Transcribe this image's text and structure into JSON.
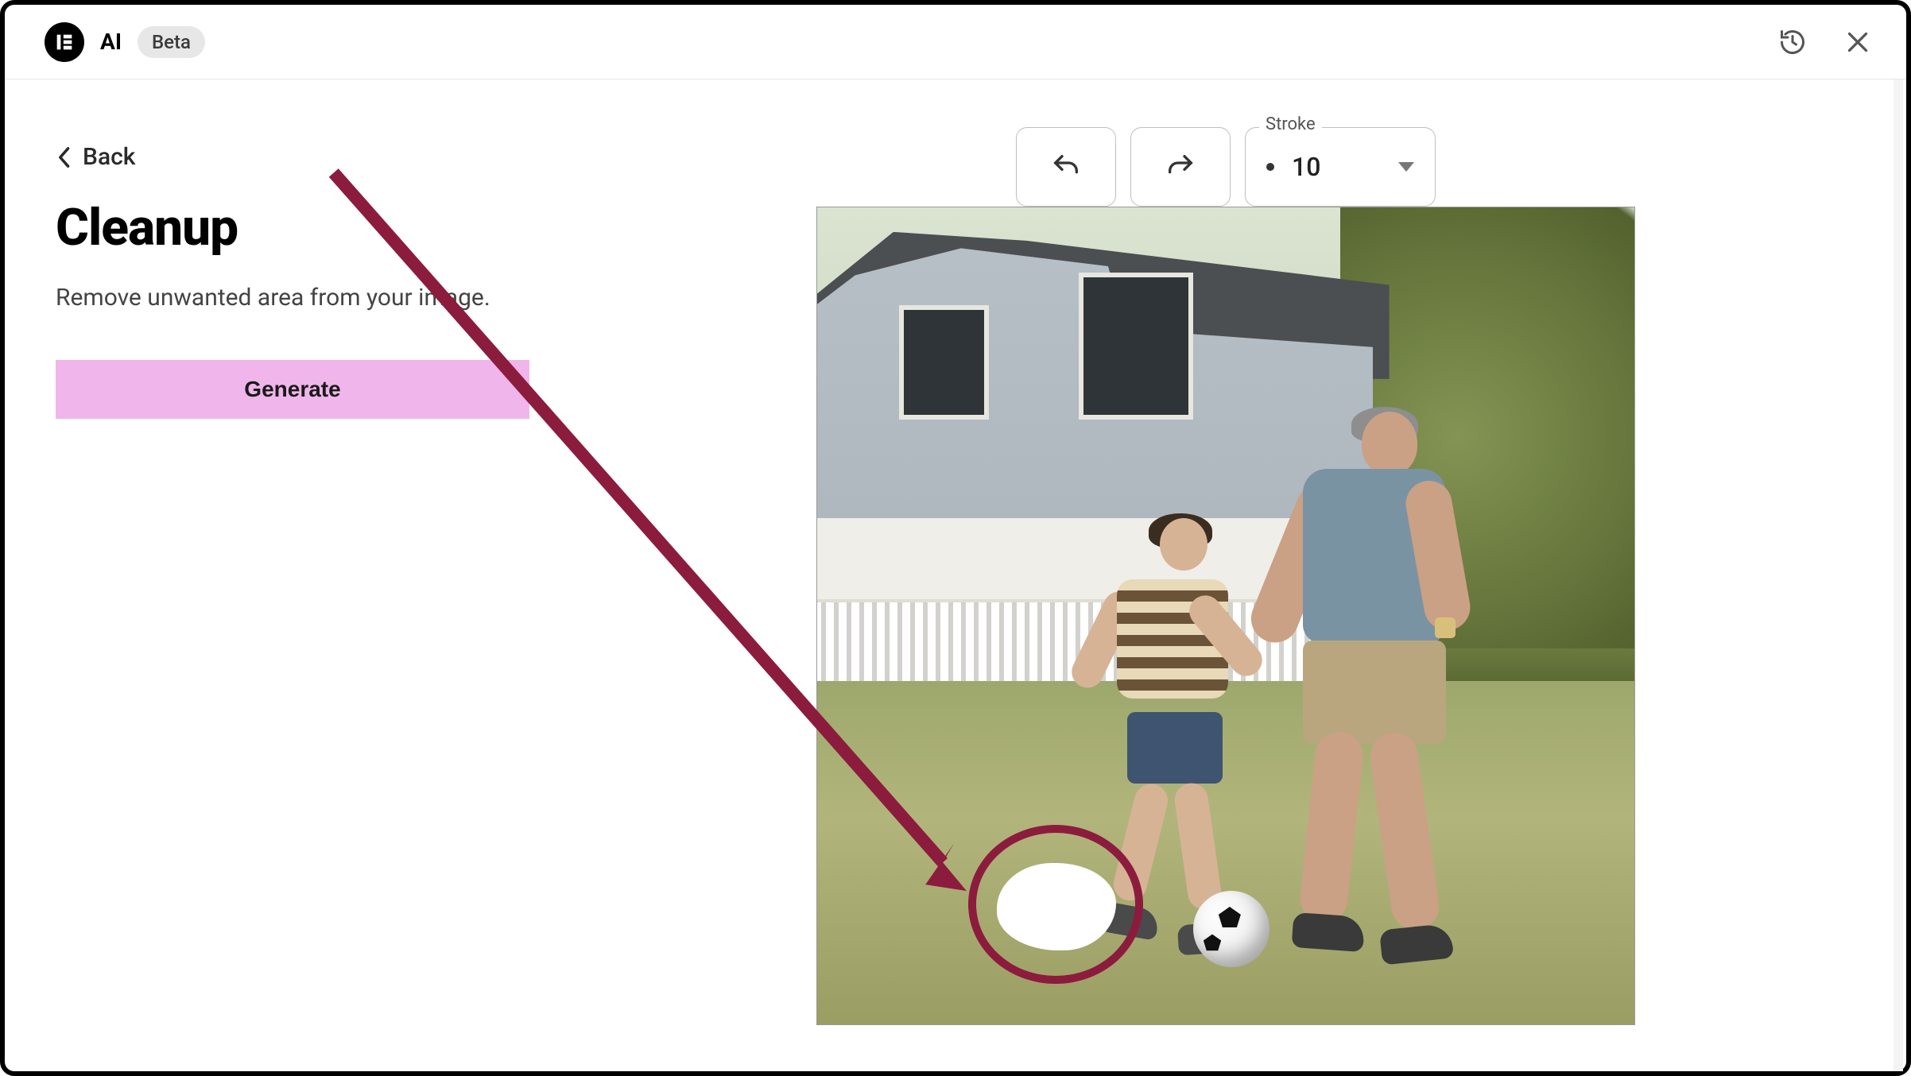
{
  "header": {
    "ai_label": "AI",
    "beta_label": "Beta"
  },
  "back": {
    "label": "Back"
  },
  "page": {
    "title": "Cleanup",
    "subtitle": "Remove unwanted area from your image."
  },
  "actions": {
    "generate_label": "Generate"
  },
  "toolbar": {
    "stroke_legend": "Stroke",
    "stroke_value": "10"
  },
  "annotation_color": "#8c1c3d"
}
